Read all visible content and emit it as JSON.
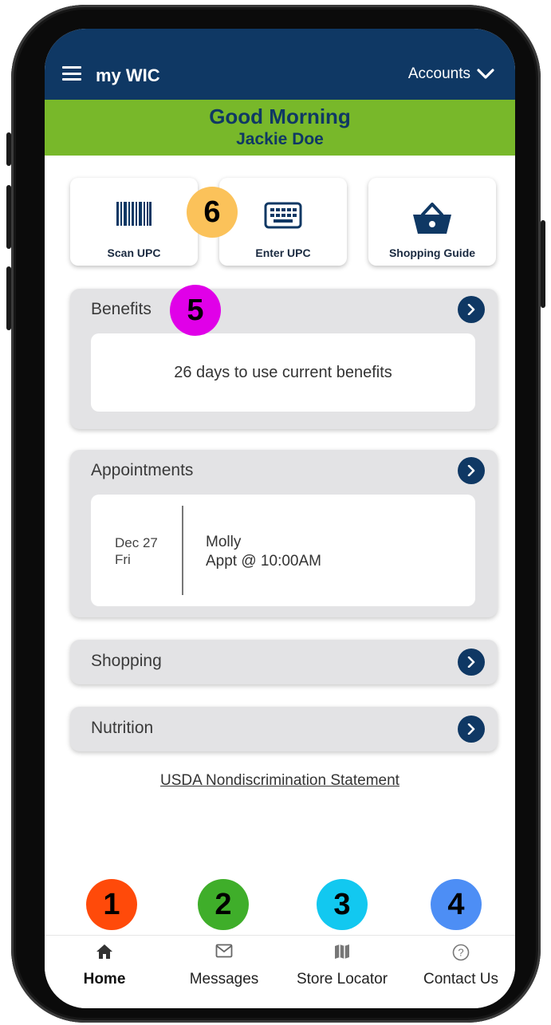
{
  "app": {
    "title": "my WIC",
    "accounts_label": "Accounts"
  },
  "greeting": {
    "line": "Good Morning",
    "name": "Jackie Doe"
  },
  "quick_actions": [
    {
      "label": "Scan UPC",
      "icon": "barcode-icon"
    },
    {
      "label": "Enter UPC",
      "icon": "keyboard-icon"
    },
    {
      "label": "Shopping Guide",
      "icon": "basket-icon"
    }
  ],
  "benefits": {
    "title": "Benefits",
    "message": "26 days to use current benefits"
  },
  "appointments": {
    "title": "Appointments",
    "date": "Dec 27",
    "day": "Fri",
    "name": "Molly",
    "detail": "Appt @ 10:00AM"
  },
  "shopping": {
    "title": "Shopping"
  },
  "nutrition": {
    "title": "Nutrition"
  },
  "footer_link": "USDA Nondiscrimination Statement",
  "tabs": [
    {
      "label": "Home",
      "icon": "home-icon"
    },
    {
      "label": "Messages",
      "icon": "mail-icon"
    },
    {
      "label": "Store Locator",
      "icon": "map-icon"
    },
    {
      "label": "Contact Us",
      "icon": "help-icon"
    }
  ],
  "annotations": [
    {
      "number": "1",
      "color": "#ff4a0a"
    },
    {
      "number": "2",
      "color": "#3fae2a"
    },
    {
      "number": "3",
      "color": "#12c8f0"
    },
    {
      "number": "4",
      "color": "#4d8ef5"
    },
    {
      "number": "5",
      "color": "#e000e8"
    },
    {
      "number": "6",
      "color": "#fbc25a"
    }
  ],
  "colors": {
    "navy": "#0f3864",
    "green": "#78b82a",
    "card_bg": "#e3e3e5"
  }
}
